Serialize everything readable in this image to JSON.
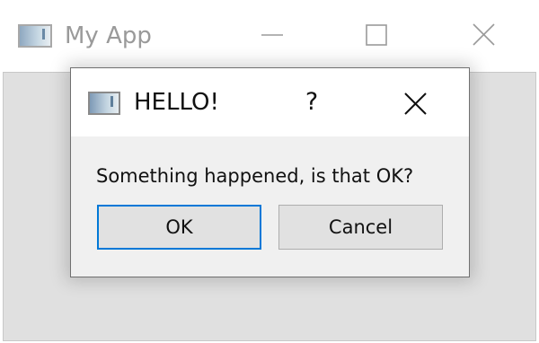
{
  "main_window": {
    "title": "My App",
    "icon": "app-window-icon",
    "controls": {
      "minimize_icon": "minimize-icon",
      "maximize_icon": "maximize-icon",
      "close_icon": "close-icon"
    }
  },
  "dialog": {
    "title": "HELLO!",
    "icon": "app-window-icon",
    "help_label": "?",
    "close_icon": "close-icon",
    "message": "Something happened, is that OK?",
    "buttons": {
      "ok_label": "OK",
      "cancel_label": "Cancel"
    },
    "default_button": "OK"
  },
  "colors": {
    "focus_accent": "#0078d7",
    "inactive_title": "#9a9a9a",
    "dialog_background": "#f0f0f0"
  }
}
